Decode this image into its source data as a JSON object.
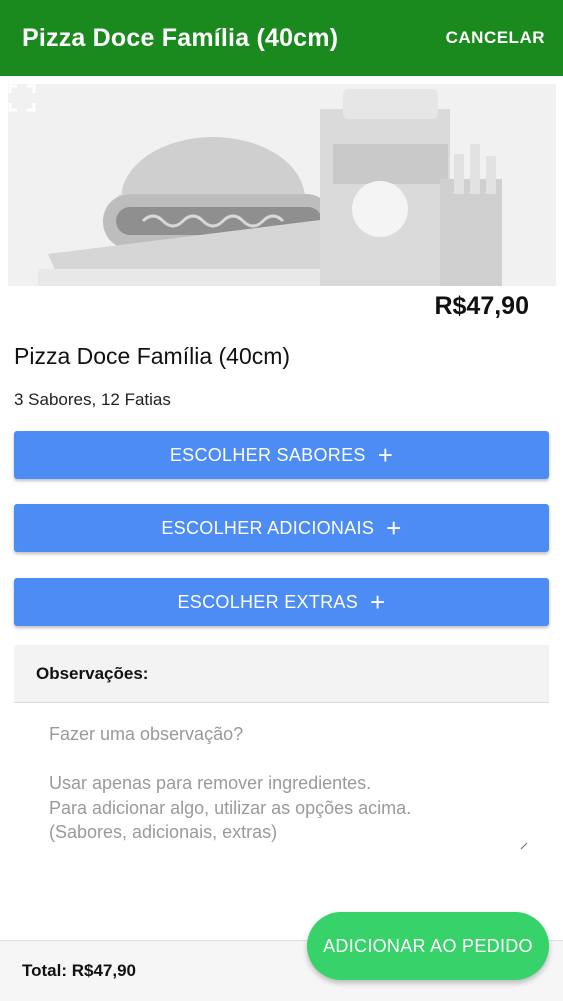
{
  "appbar": {
    "title": "Pizza Doce Família (40cm)",
    "cancel_label": "CANCELAR",
    "color": "#1a8a1f"
  },
  "product": {
    "price": "R$47,90",
    "name": "Pizza Doce Família (40cm)",
    "description": "3 Sabores, 12 Fatias",
    "image_icon": "expand-icon"
  },
  "buttons": {
    "flavors": "ESCOLHER SABORES",
    "additionals": "ESCOLHER ADICIONAIS",
    "extras": "ESCOLHER EXTRAS",
    "plus": "+",
    "color": "#4d8cf5"
  },
  "observations": {
    "header": "Observações:",
    "placeholder": "Fazer uma observação?\n\nUsar apenas para remover ingredientes.\nPara adicionar algo, utilizar as opções acima.\n(Sabores, adicionais, extras)"
  },
  "footer": {
    "total": "Total: R$47,90",
    "add_button": "ADICIONAR AO PEDIDO",
    "add_color": "#37d36a"
  }
}
